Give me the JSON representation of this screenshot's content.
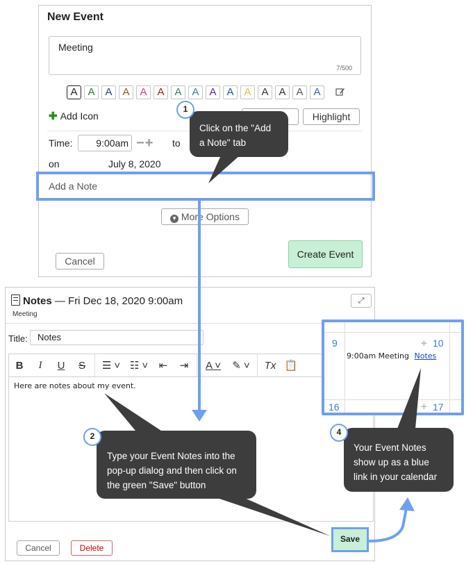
{
  "new_event": {
    "title": "New Event",
    "title_value": "Meeting",
    "title_count": "7/500",
    "color_chip_letter": "A",
    "chip_colors": [
      "#222222",
      "#2e7d32",
      "#1e3c9e",
      "#8a5a1e",
      "#d6437b",
      "#8b1a1a",
      "#2e7d5a",
      "#2a8a8a",
      "#5a2a8a",
      "#1f4fa8",
      "#e6b84a",
      "#333333",
      "#333333",
      "#555555",
      "#2f63c0"
    ],
    "add_icon_label": "Add Icon",
    "highlight_label": "Highlight",
    "time_label": "Time:",
    "time_value": "9:00am",
    "to_label": "to",
    "on_label": "on",
    "date_value": "July 8, 2020",
    "add_note_label": "Add a Note",
    "more_options_label": "More Options",
    "create_label": "Create Event",
    "cancel_label": "Cancel"
  },
  "notes_dialog": {
    "title": "Notes",
    "datetime": "— Fri Dec 18, 2020 9:00am",
    "subtitle": "Meeting",
    "title_label": "Title:",
    "title_value": "Notes",
    "editor_text": "Here are notes about my event.",
    "cancel_label": "Cancel",
    "delete_label": "Delete",
    "save_label": "Save"
  },
  "calendar": {
    "day_9": "9",
    "day_10": "10",
    "day_16": "16",
    "day_17": "17",
    "event_text": "9:00am Meeting",
    "event_link": "Notes"
  },
  "callouts": {
    "c1_num": "1",
    "c1_text": "Click on the \"Add a Note\" tab",
    "c2_num": "2",
    "c2_text": "Type your Event Notes into the pop-up dialog and then click on the green \"Save\" button",
    "c4_num": "4",
    "c4_text": "Your Event Notes show up as a blue link in your calendar"
  },
  "colors": {
    "accent_blue": "#6fa0f0",
    "save_green": "#c7f0d6",
    "callout_bg": "#3d3d3d"
  }
}
